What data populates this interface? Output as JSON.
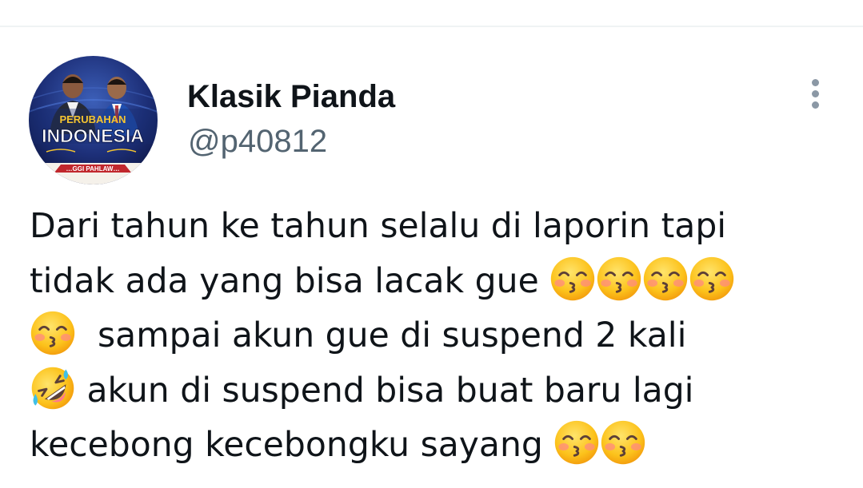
{
  "tweet": {
    "author": {
      "display_name": "Klasik Pianda",
      "handle": "@p40812",
      "avatar": {
        "icon": "profile-avatar-image",
        "text_line1": "PERUBAHAN",
        "text_line2": "INDONESIA",
        "bottom_text": "…GGI PAHLAW…"
      }
    },
    "more_icon": "more-options-icon",
    "lines": [
      {
        "segments": [
          {
            "text": "Dari tahun ke tahun selalu di laporin tapi"
          }
        ]
      },
      {
        "segments": [
          {
            "text": "tidak ada yang bisa lacak gue "
          },
          {
            "emoji": "kissing-face-with-smiling-eyes"
          },
          {
            "emoji": "kissing-face-with-smiling-eyes"
          },
          {
            "emoji": "kissing-face-with-smiling-eyes"
          },
          {
            "emoji": "kissing-face-with-smiling-eyes"
          }
        ]
      },
      {
        "segments": [
          {
            "emoji": "kissing-face-with-smiling-eyes"
          },
          {
            "text": "  sampai akun gue di suspend 2 kali"
          }
        ]
      },
      {
        "segments": [
          {
            "emoji": "rolling-on-the-floor-laughing"
          },
          {
            "text": " akun di suspend bisa buat baru lagi"
          }
        ]
      },
      {
        "segments": [
          {
            "text": "kecebong kecebongku sayang "
          },
          {
            "emoji": "kissing-face-with-smiling-eyes"
          },
          {
            "emoji": "kissing-face-with-smiling-eyes"
          }
        ]
      }
    ]
  },
  "colors": {
    "text_primary": "#0f1419",
    "text_secondary": "#536471",
    "divider": "#eff3f4",
    "icon_gray": "#8b98a5"
  }
}
